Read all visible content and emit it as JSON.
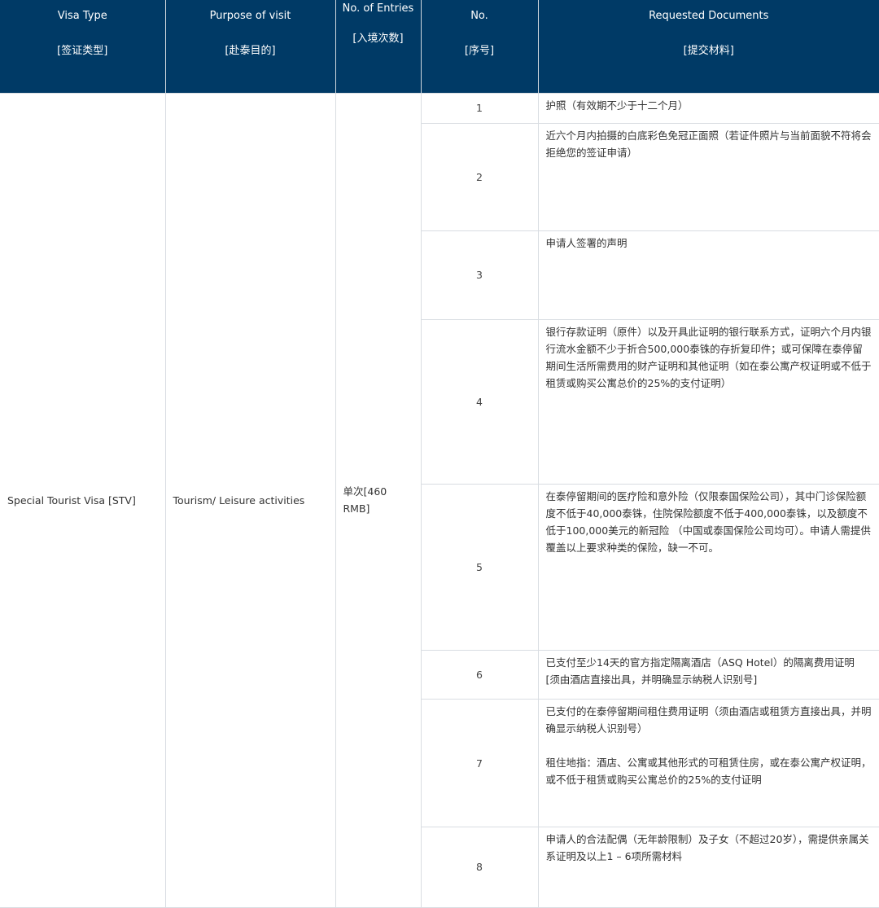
{
  "header": {
    "visa_type_en": "Visa Type",
    "visa_type_zh": "[签证类型]",
    "purpose_en": "Purpose of visit",
    "purpose_zh": "[赴泰目的]",
    "entries_en": "No. of Entries",
    "entries_zh": "[入境次数]",
    "no_en": "No.",
    "no_zh": "[序号]",
    "docs_en": "Requested Documents",
    "docs_zh": "[提交材料]"
  },
  "row": {
    "visa_type": "Special Tourist Visa [STV]",
    "purpose": "Tourism/ Leisure activities",
    "entries": "单次[460 RMB]"
  },
  "documents": [
    {
      "no": "1",
      "text": [
        "护照（有效期不少于十二个月）"
      ]
    },
    {
      "no": "2",
      "text": [
        "近六个月内拍摄的白底彩色免冠正面照（若证件照片与当前面貌不符将会拒绝您的签证申请）"
      ]
    },
    {
      "no": "3",
      "text": [
        "申请人签署的声明"
      ]
    },
    {
      "no": "4",
      "text": [
        "银行存款证明（原件）以及开具此证明的银行联系方式，证明六个月内银行流水金额不少于折合500,000泰铢的存折复印件；或可保障在泰停留期间生活所需费用的财产证明和其他证明（如在泰公寓产权证明或不低于租赁或购买公寓总价的25%的支付证明）"
      ]
    },
    {
      "no": "5",
      "text": [
        "在泰停留期间的医疗险和意外险（仅限泰国保险公司），其中门诊保险额度不低于40,000泰铢，住院保险额度不低于400,000泰铢，以及额度不低于100,000美元的新冠险 （中国或泰国保险公司均可）。申请人需提供覆盖以上要求种类的保险，缺一不可。"
      ]
    },
    {
      "no": "6",
      "text": [
        "已支付至少14天的官方指定隔离酒店（ASQ Hotel）的隔离费用证明 [须由酒店直接出具，并明确显示纳税人识别号]"
      ]
    },
    {
      "no": "7",
      "text": [
        "已支付的在泰停留期间租住费用证明（须由酒店或租赁方直接出具，并明确显示纳税人识别号）",
        "租住地指：酒店、公寓或其他形式的可租赁住房，或在泰公寓产权证明，或不低于租赁或购买公寓总价的25%的支付证明"
      ]
    },
    {
      "no": "8",
      "text": [
        "申请人的合法配偶（无年龄限制）及子女（不超过20岁），需提供亲属关系证明及以上1 – 6项所需材料"
      ]
    }
  ]
}
